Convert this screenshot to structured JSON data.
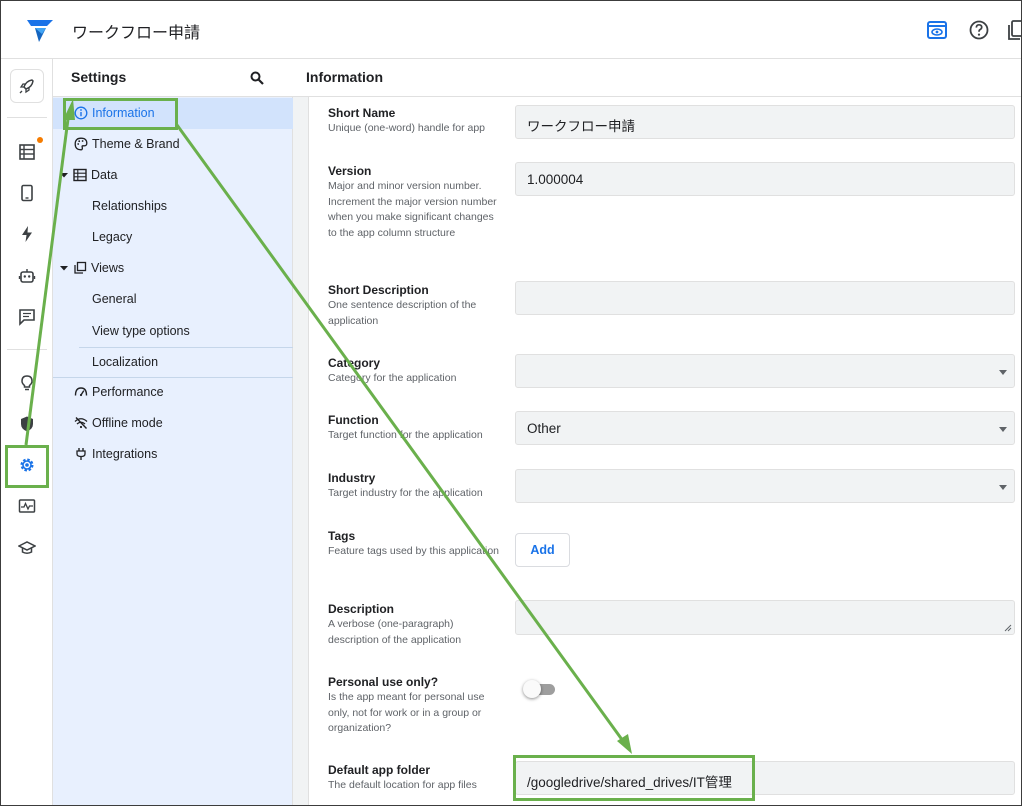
{
  "app": {
    "title": "ワークフロー申請",
    "accent": "#1a73e8",
    "annotation_color": "#6ab04c"
  },
  "topbar": {
    "icons": [
      "preview-icon",
      "help-icon",
      "copy-icon"
    ]
  },
  "rail": {
    "icons": [
      "launch-icon",
      "data-icon",
      "app-icon",
      "automation-icon",
      "bot-icon",
      "chat-icon",
      "idea-icon",
      "security-icon",
      "settings-icon",
      "monitor-icon",
      "learn-icon"
    ]
  },
  "settings": {
    "title": "Settings",
    "items": [
      {
        "label": "Information",
        "icon": "info-icon",
        "active": true
      },
      {
        "label": "Theme & Brand",
        "icon": "palette-icon"
      },
      {
        "label": "Data",
        "icon": "table-icon",
        "expanded": true
      },
      {
        "label": "Relationships"
      },
      {
        "label": "Legacy"
      },
      {
        "label": "Views",
        "icon": "views-icon",
        "expanded": true
      },
      {
        "label": "General"
      },
      {
        "label": "View type options"
      },
      {
        "label": "Localization"
      },
      {
        "label": "Performance",
        "icon": "speed-icon"
      },
      {
        "label": "Offline mode",
        "icon": "offline-icon"
      },
      {
        "label": "Integrations",
        "icon": "plug-icon"
      }
    ]
  },
  "main": {
    "title": "Information",
    "fields": {
      "short_name": {
        "name": "Short Name",
        "desc": "Unique (one-word) handle for app",
        "value": "ワークフロー申請"
      },
      "version": {
        "name": "Version",
        "desc": "Major and minor version number. Increment the major version number when you make significant changes to the app column structure",
        "value": "1.000004"
      },
      "short_description": {
        "name": "Short Description",
        "desc": "One sentence description of the application",
        "value": ""
      },
      "category": {
        "name": "Category",
        "desc": "Category for the application",
        "value": ""
      },
      "function": {
        "name": "Function",
        "desc": "Target function for the application",
        "value": "Other"
      },
      "industry": {
        "name": "Industry",
        "desc": "Target industry for the application",
        "value": ""
      },
      "tags": {
        "name": "Tags",
        "desc": "Feature tags used by this application",
        "button": "Add"
      },
      "description": {
        "name": "Description",
        "desc": "A verbose (one-paragraph) description of the application",
        "value": ""
      },
      "personal_use": {
        "name": "Personal use only?",
        "desc": "Is the app meant for personal use only, not for work or in a group or organization?",
        "on": false
      },
      "default_folder": {
        "name": "Default app folder",
        "desc": "The default location for app files",
        "value": "/googledrive/shared_drives/IT管理"
      }
    }
  }
}
